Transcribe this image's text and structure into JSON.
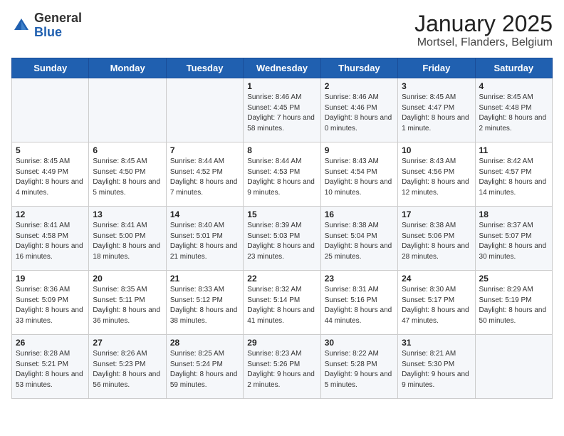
{
  "header": {
    "logo_general": "General",
    "logo_blue": "Blue",
    "title": "January 2025",
    "subtitle": "Mortsel, Flanders, Belgium"
  },
  "weekdays": [
    "Sunday",
    "Monday",
    "Tuesday",
    "Wednesday",
    "Thursday",
    "Friday",
    "Saturday"
  ],
  "weeks": [
    [
      {
        "day": "",
        "info": ""
      },
      {
        "day": "",
        "info": ""
      },
      {
        "day": "",
        "info": ""
      },
      {
        "day": "1",
        "info": "Sunrise: 8:46 AM\nSunset: 4:45 PM\nDaylight: 7 hours and 58 minutes."
      },
      {
        "day": "2",
        "info": "Sunrise: 8:46 AM\nSunset: 4:46 PM\nDaylight: 8 hours and 0 minutes."
      },
      {
        "day": "3",
        "info": "Sunrise: 8:45 AM\nSunset: 4:47 PM\nDaylight: 8 hours and 1 minute."
      },
      {
        "day": "4",
        "info": "Sunrise: 8:45 AM\nSunset: 4:48 PM\nDaylight: 8 hours and 2 minutes."
      }
    ],
    [
      {
        "day": "5",
        "info": "Sunrise: 8:45 AM\nSunset: 4:49 PM\nDaylight: 8 hours and 4 minutes."
      },
      {
        "day": "6",
        "info": "Sunrise: 8:45 AM\nSunset: 4:50 PM\nDaylight: 8 hours and 5 minutes."
      },
      {
        "day": "7",
        "info": "Sunrise: 8:44 AM\nSunset: 4:52 PM\nDaylight: 8 hours and 7 minutes."
      },
      {
        "day": "8",
        "info": "Sunrise: 8:44 AM\nSunset: 4:53 PM\nDaylight: 8 hours and 9 minutes."
      },
      {
        "day": "9",
        "info": "Sunrise: 8:43 AM\nSunset: 4:54 PM\nDaylight: 8 hours and 10 minutes."
      },
      {
        "day": "10",
        "info": "Sunrise: 8:43 AM\nSunset: 4:56 PM\nDaylight: 8 hours and 12 minutes."
      },
      {
        "day": "11",
        "info": "Sunrise: 8:42 AM\nSunset: 4:57 PM\nDaylight: 8 hours and 14 minutes."
      }
    ],
    [
      {
        "day": "12",
        "info": "Sunrise: 8:41 AM\nSunset: 4:58 PM\nDaylight: 8 hours and 16 minutes."
      },
      {
        "day": "13",
        "info": "Sunrise: 8:41 AM\nSunset: 5:00 PM\nDaylight: 8 hours and 18 minutes."
      },
      {
        "day": "14",
        "info": "Sunrise: 8:40 AM\nSunset: 5:01 PM\nDaylight: 8 hours and 21 minutes."
      },
      {
        "day": "15",
        "info": "Sunrise: 8:39 AM\nSunset: 5:03 PM\nDaylight: 8 hours and 23 minutes."
      },
      {
        "day": "16",
        "info": "Sunrise: 8:38 AM\nSunset: 5:04 PM\nDaylight: 8 hours and 25 minutes."
      },
      {
        "day": "17",
        "info": "Sunrise: 8:38 AM\nSunset: 5:06 PM\nDaylight: 8 hours and 28 minutes."
      },
      {
        "day": "18",
        "info": "Sunrise: 8:37 AM\nSunset: 5:07 PM\nDaylight: 8 hours and 30 minutes."
      }
    ],
    [
      {
        "day": "19",
        "info": "Sunrise: 8:36 AM\nSunset: 5:09 PM\nDaylight: 8 hours and 33 minutes."
      },
      {
        "day": "20",
        "info": "Sunrise: 8:35 AM\nSunset: 5:11 PM\nDaylight: 8 hours and 36 minutes."
      },
      {
        "day": "21",
        "info": "Sunrise: 8:33 AM\nSunset: 5:12 PM\nDaylight: 8 hours and 38 minutes."
      },
      {
        "day": "22",
        "info": "Sunrise: 8:32 AM\nSunset: 5:14 PM\nDaylight: 8 hours and 41 minutes."
      },
      {
        "day": "23",
        "info": "Sunrise: 8:31 AM\nSunset: 5:16 PM\nDaylight: 8 hours and 44 minutes."
      },
      {
        "day": "24",
        "info": "Sunrise: 8:30 AM\nSunset: 5:17 PM\nDaylight: 8 hours and 47 minutes."
      },
      {
        "day": "25",
        "info": "Sunrise: 8:29 AM\nSunset: 5:19 PM\nDaylight: 8 hours and 50 minutes."
      }
    ],
    [
      {
        "day": "26",
        "info": "Sunrise: 8:28 AM\nSunset: 5:21 PM\nDaylight: 8 hours and 53 minutes."
      },
      {
        "day": "27",
        "info": "Sunrise: 8:26 AM\nSunset: 5:23 PM\nDaylight: 8 hours and 56 minutes."
      },
      {
        "day": "28",
        "info": "Sunrise: 8:25 AM\nSunset: 5:24 PM\nDaylight: 8 hours and 59 minutes."
      },
      {
        "day": "29",
        "info": "Sunrise: 8:23 AM\nSunset: 5:26 PM\nDaylight: 9 hours and 2 minutes."
      },
      {
        "day": "30",
        "info": "Sunrise: 8:22 AM\nSunset: 5:28 PM\nDaylight: 9 hours and 5 minutes."
      },
      {
        "day": "31",
        "info": "Sunrise: 8:21 AM\nSunset: 5:30 PM\nDaylight: 9 hours and 9 minutes."
      },
      {
        "day": "",
        "info": ""
      }
    ]
  ]
}
